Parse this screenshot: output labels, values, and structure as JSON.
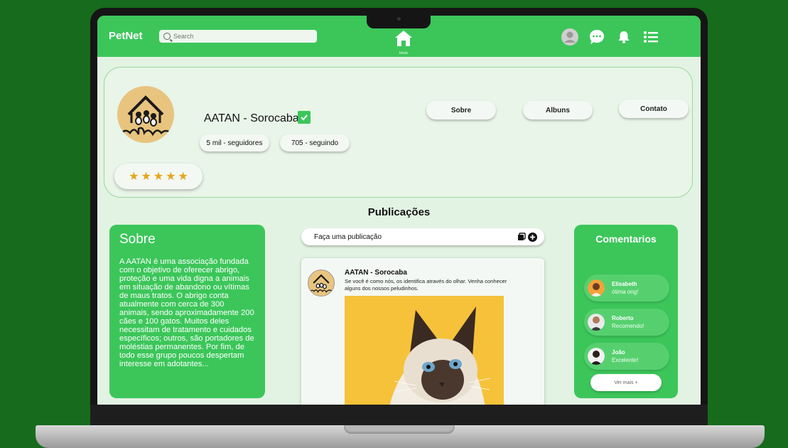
{
  "app": {
    "logo": "PetNet"
  },
  "search": {
    "placeholder": "Search"
  },
  "nav": {
    "home_label": "Início"
  },
  "profile": {
    "name": "AATAN - Sorocaba",
    "followers": "5 mil - seguidores",
    "following": "705 - seguindo",
    "rating": 5,
    "tabs": [
      {
        "label": "Sobre"
      },
      {
        "label": "Albuns"
      },
      {
        "label": "Contato"
      }
    ]
  },
  "publications": {
    "title": "Publicações"
  },
  "about": {
    "title": "Sobre",
    "text": "A AATAN é uma associação fundada com o objetivo de oferecer abrigo, proteção e uma vida digna a animais em situação de abandono ou vítimas de maus tratos. O abrigo conta atualmente com cerca de 300 animais, sendo aproximadamente 200 cães e 100 gatos. Muitos deles necessitam de tratamento e cuidados específicos; outros, são portadores de moléstias permanentes. Por fim, de todo esse grupo poucos despertam interesse em adotantes..."
  },
  "composer": {
    "placeholder": "Faça uma publicação"
  },
  "post": {
    "author": "AATAN - Sorocaba",
    "text": "Se você é como nós, os identifica através do olhar. Venha conhecer alguns dos nossos peludinhos."
  },
  "comments": {
    "title": "Comentarios",
    "items": [
      {
        "name": "Elisabeth",
        "text": "ótima ong!"
      },
      {
        "name": "Roberto",
        "text": "Recomendo!"
      },
      {
        "name": "João",
        "text": "Excelente!"
      }
    ],
    "more_label": "Ver mais +"
  },
  "colors": {
    "brand": "#3cc65a",
    "background": "#176b1c",
    "screen": "#e3f3e3"
  }
}
